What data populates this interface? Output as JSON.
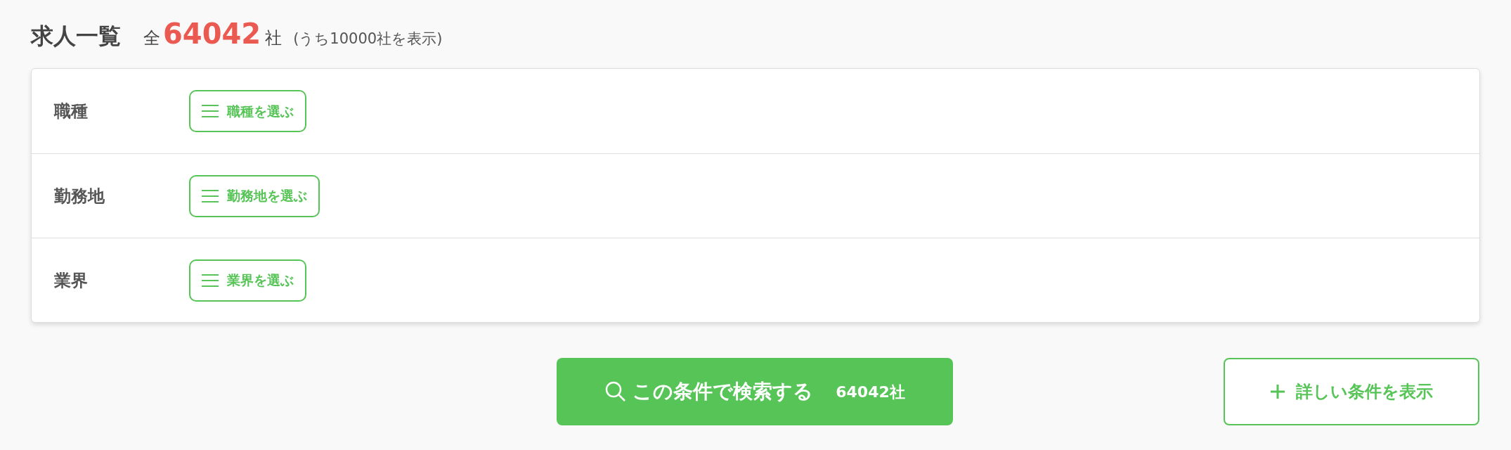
{
  "header": {
    "title": "求人一覧",
    "total_prefix": "全",
    "total_count": "64042",
    "total_suffix": "社",
    "shown_note": "(うち10000社を表示)"
  },
  "filters": [
    {
      "label": "職種",
      "button": "職種を選ぶ"
    },
    {
      "label": "勤務地",
      "button": "勤務地を選ぶ"
    },
    {
      "label": "業界",
      "button": "業界を選ぶ"
    }
  ],
  "search_button": {
    "label": "この条件で検索する",
    "count": "64042社"
  },
  "more_button": {
    "label": "詳しい条件を表示"
  }
}
